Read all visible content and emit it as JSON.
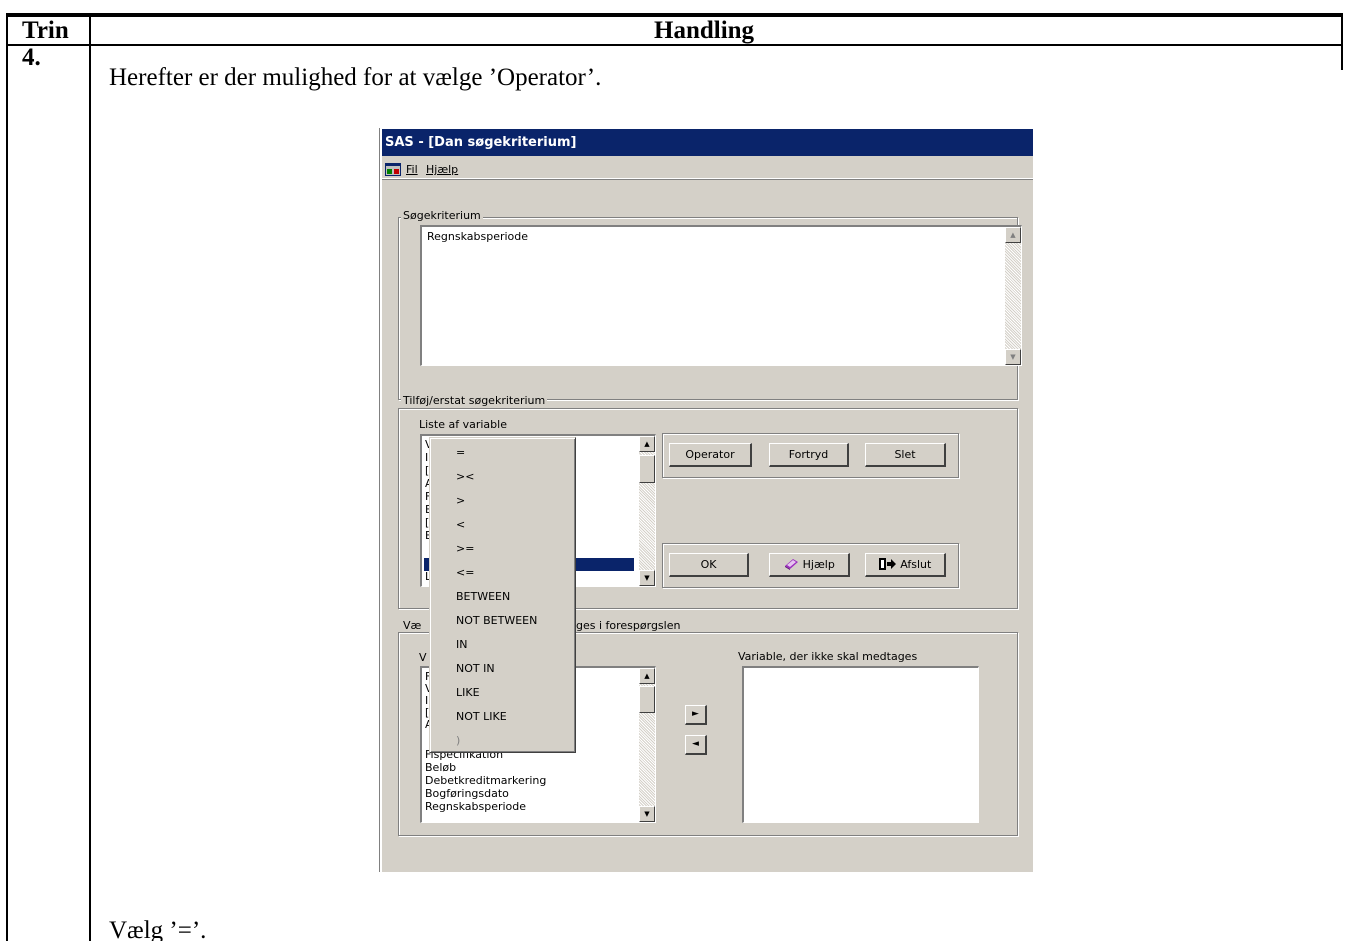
{
  "table": {
    "col_step": "Trin",
    "col_action": "Handling",
    "step_number": "4.",
    "instruction_top": "Herefter er der mulighed for at vælge ’Operator’.",
    "instruction_bottom": "Vælg ’=’."
  },
  "window": {
    "title": "SAS - [Dan søgekriterium]",
    "menu": [
      "Fil",
      "Hjælp"
    ]
  },
  "criteria": {
    "group_label": "Søgekriterium",
    "text": "Regnskabsperiode"
  },
  "add_replace": {
    "group_label": "Tilføj/erstat søgekriterium",
    "list_label": "Liste af variable",
    "list_visible_chars": [
      "V",
      "I",
      "[",
      "A",
      "F",
      "E",
      "[",
      "E",
      "F",
      "L"
    ],
    "buttons": {
      "operator": "Operator",
      "undo": "Fortryd",
      "delete": "Slet",
      "ok": "OK",
      "help": "Hjælp",
      "exit": "Afslut"
    }
  },
  "operator_menu": [
    "=",
    "><",
    ">",
    "<",
    ">=",
    "<=",
    "BETWEEN",
    "NOT BETWEEN",
    "IN",
    "NOT IN",
    "LIKE",
    "NOT LIKE",
    ")"
  ],
  "select_vars": {
    "group_label_start": "Væ",
    "group_label_end": "ges i forespørgslen",
    "left_label_start": "V",
    "left_list_visible_chars": [
      "F",
      "V",
      "I",
      "[",
      "A"
    ],
    "left_list": [
      "Fispecifikation",
      "Beløb",
      "Debetkreditmarkering",
      "Bogføringsdato",
      "Regnskabsperiode"
    ],
    "right_label": "Variable, der ikke skal medtages",
    "move_right": "►",
    "move_left": "◄"
  },
  "icons": {
    "scroll_up": "▲",
    "scroll_down": "▼",
    "help_book": "help-book-icon",
    "exit_door": "exit-door-icon",
    "app": "sas-app-icon"
  },
  "colors": {
    "titlebar": "#0a246a",
    "face": "#d4d0c8",
    "selection": "#0a246a"
  }
}
